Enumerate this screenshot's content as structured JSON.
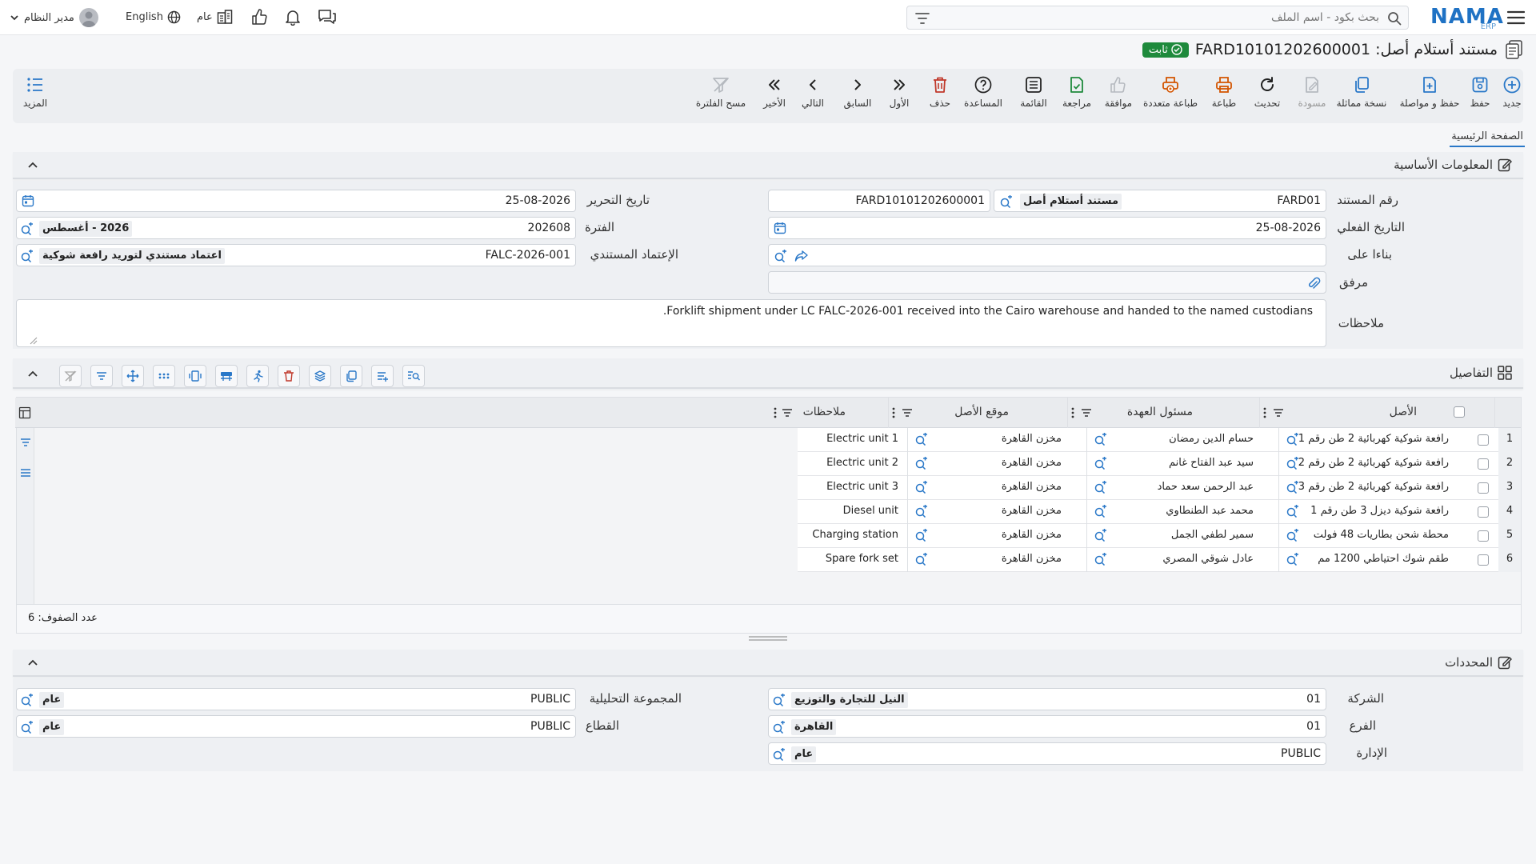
{
  "topbar": {
    "search_placeholder": "بحث بكود - اسم الملف",
    "logo": "NAMA",
    "logo_sub": "ERP",
    "user_name": "مدير النظام",
    "language": "English",
    "scope": "عام"
  },
  "title": {
    "text": "مستند أستلام أصل: FARD10101202600001",
    "status": "ثابت"
  },
  "toolbar": [
    {
      "label": "جديد",
      "icon": "plus-circle-icon"
    },
    {
      "label": "حفظ",
      "icon": "save-icon"
    },
    {
      "label": "حفظ و مواصلة",
      "icon": "save-continue-icon"
    },
    {
      "label": "نسخة مماثلة",
      "icon": "copy-icon"
    },
    {
      "label": "مسودة",
      "icon": "draft-icon"
    },
    {
      "label": "تحديث",
      "icon": "refresh-icon"
    },
    {
      "label": "طباعة",
      "icon": "print-icon"
    },
    {
      "label": "طباعة متعددة",
      "icon": "multi-print-icon"
    },
    {
      "label": "موافقة",
      "icon": "thumbs-up-icon"
    },
    {
      "label": "مراجعة",
      "icon": "review-icon"
    },
    {
      "label": "القائمة",
      "icon": "list-icon"
    },
    {
      "label": "المساعدة",
      "icon": "help-icon"
    },
    {
      "label": "حذف",
      "icon": "trash-icon"
    },
    {
      "label": "الأول",
      "icon": "first-icon"
    },
    {
      "label": "السابق",
      "icon": "previous-icon"
    },
    {
      "label": "التالي",
      "icon": "next-icon"
    },
    {
      "label": "الأخير",
      "icon": "last-icon"
    },
    {
      "label": "مسح الفلترة",
      "icon": "clear-filter-icon"
    }
  ],
  "toolbar_more": "المزيد",
  "tabs": {
    "main": "الصفحة الرئيسية"
  },
  "basic": {
    "header": "المعلومات الأساسية",
    "doc_number_label": "رقم المستند",
    "doc_number_code": "FARD01",
    "doc_number_type": "مستند أستلام أصل",
    "doc_number_full": "FARD10101202600001",
    "actual_date_label": "التاريخ الفعلي",
    "actual_date": "25-08-2026",
    "based_on_label": "بناءا على",
    "attachment_label": "مرفق",
    "notes_label": "ملاحظات",
    "notes": "Forklift shipment under LC FALC-2026-001 received into the Cairo warehouse and handed to the named custodians.",
    "edit_date_label": "تاريخ التحرير",
    "edit_date": "25-08-2026",
    "period_label": "الفترة",
    "period_code": "202608",
    "period_name": "2026 - أغسطس",
    "credit_label": "الإعتماد المستندي",
    "credit_code": "FALC-2026-001",
    "credit_name": "اعتماد مستندي لتوريد رافعة شوكية"
  },
  "details": {
    "header": "التفاصيل",
    "columns": {
      "asset": "الأصل",
      "custodian": "مسئول العهدة",
      "location": "موقع الأصل",
      "notes": "ملاحظات"
    },
    "rows": [
      {
        "n": "1",
        "asset": "رافعة شوكية كهربائية 2 طن رقم 1",
        "custodian": "حسام الدين رمضان",
        "location": "مخزن القاهرة",
        "notes": "Electric unit 1"
      },
      {
        "n": "2",
        "asset": "رافعة شوكية كهربائية 2 طن رقم 2",
        "custodian": "سيد عبد الفتاح غانم",
        "location": "مخزن القاهرة",
        "notes": "Electric unit 2"
      },
      {
        "n": "3",
        "asset": "رافعة شوكية كهربائية 2 طن رقم 3",
        "custodian": "عبد الرحمن سعد حماد",
        "location": "مخزن القاهرة",
        "notes": "Electric unit 3"
      },
      {
        "n": "4",
        "asset": "رافعة شوكية ديزل 3 طن رقم 1",
        "custodian": "محمد عبد الطنطاوي",
        "location": "مخزن القاهرة",
        "notes": "Diesel unit"
      },
      {
        "n": "5",
        "asset": "محطة شحن بطاريات 48 فولت",
        "custodian": "سمير لطفي الجمل",
        "location": "مخزن القاهرة",
        "notes": "Charging station"
      },
      {
        "n": "6",
        "asset": "طقم شوك احتياطي 1200 مم",
        "custodian": "عادل شوقي المصري",
        "location": "مخزن القاهرة",
        "notes": "Spare fork set"
      }
    ],
    "row_count": "عدد الصفوف: 6"
  },
  "dimensions": {
    "header": "المحددات",
    "company_label": "الشركة",
    "company_code": "01",
    "company_name": "النيل للتجارة والتوزيع",
    "branch_label": "الفرع",
    "branch_code": "01",
    "branch_name": "القاهرة",
    "dept_label": "الإدارة",
    "dept_code": "PUBLIC",
    "dept_name": "عام",
    "analytic_label": "المجموعة التحليلية",
    "analytic_code": "PUBLIC",
    "analytic_name": "عام",
    "sector_label": "القطاع",
    "sector_code": "PUBLIC",
    "sector_name": "عام"
  },
  "colors": {
    "accent": "#2a78c8",
    "status": "#1e8a3c",
    "danger": "#c0392b"
  }
}
